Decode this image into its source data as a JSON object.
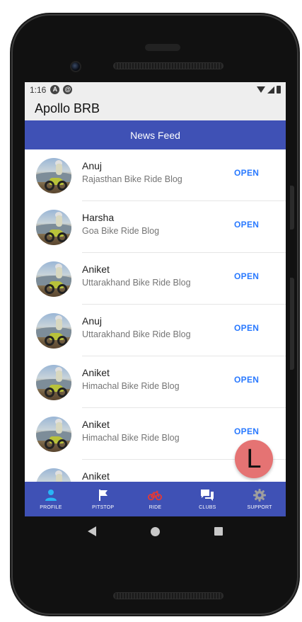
{
  "status": {
    "time": "1:16",
    "icon_a": "A",
    "icon_b": "@"
  },
  "app": {
    "title": "Apollo BRB"
  },
  "newsfeed": {
    "label": "News Feed"
  },
  "feed": [
    {
      "name": "Anuj",
      "subtitle": "Rajasthan Bike Ride Blog",
      "action": "OPEN"
    },
    {
      "name": "Harsha",
      "subtitle": "Goa Bike Ride Blog",
      "action": "OPEN"
    },
    {
      "name": "Aniket",
      "subtitle": "Uttarakhand Bike Ride Blog",
      "action": "OPEN"
    },
    {
      "name": "Anuj",
      "subtitle": "Uttarakhand Bike Ride Blog",
      "action": "OPEN"
    },
    {
      "name": "Aniket",
      "subtitle": "Himachal Bike Ride Blog",
      "action": "OPEN"
    },
    {
      "name": "Aniket",
      "subtitle": "Himachal Bike Ride Blog",
      "action": "OPEN"
    },
    {
      "name": "Aniket",
      "subtitle": "",
      "action": ""
    }
  ],
  "fab": {
    "letter": "L",
    "color": "#e57373"
  },
  "tabs": [
    {
      "label": "PROFILE",
      "icon": "person-icon",
      "color": "#29b6f6"
    },
    {
      "label": "PITSTOP",
      "icon": "flag-icon",
      "color": "#ffffff"
    },
    {
      "label": "RIDE",
      "icon": "bicycle-icon",
      "color": "#e53935"
    },
    {
      "label": "CLUBS",
      "icon": "chat-icon",
      "color": "#ffffff"
    },
    {
      "label": "SUPPORT",
      "icon": "gear-icon",
      "color": "#9e9e9e"
    }
  ],
  "colors": {
    "primary": "#3f51b5",
    "accent": "#2979ff",
    "statusbar": "#eeeeee"
  }
}
